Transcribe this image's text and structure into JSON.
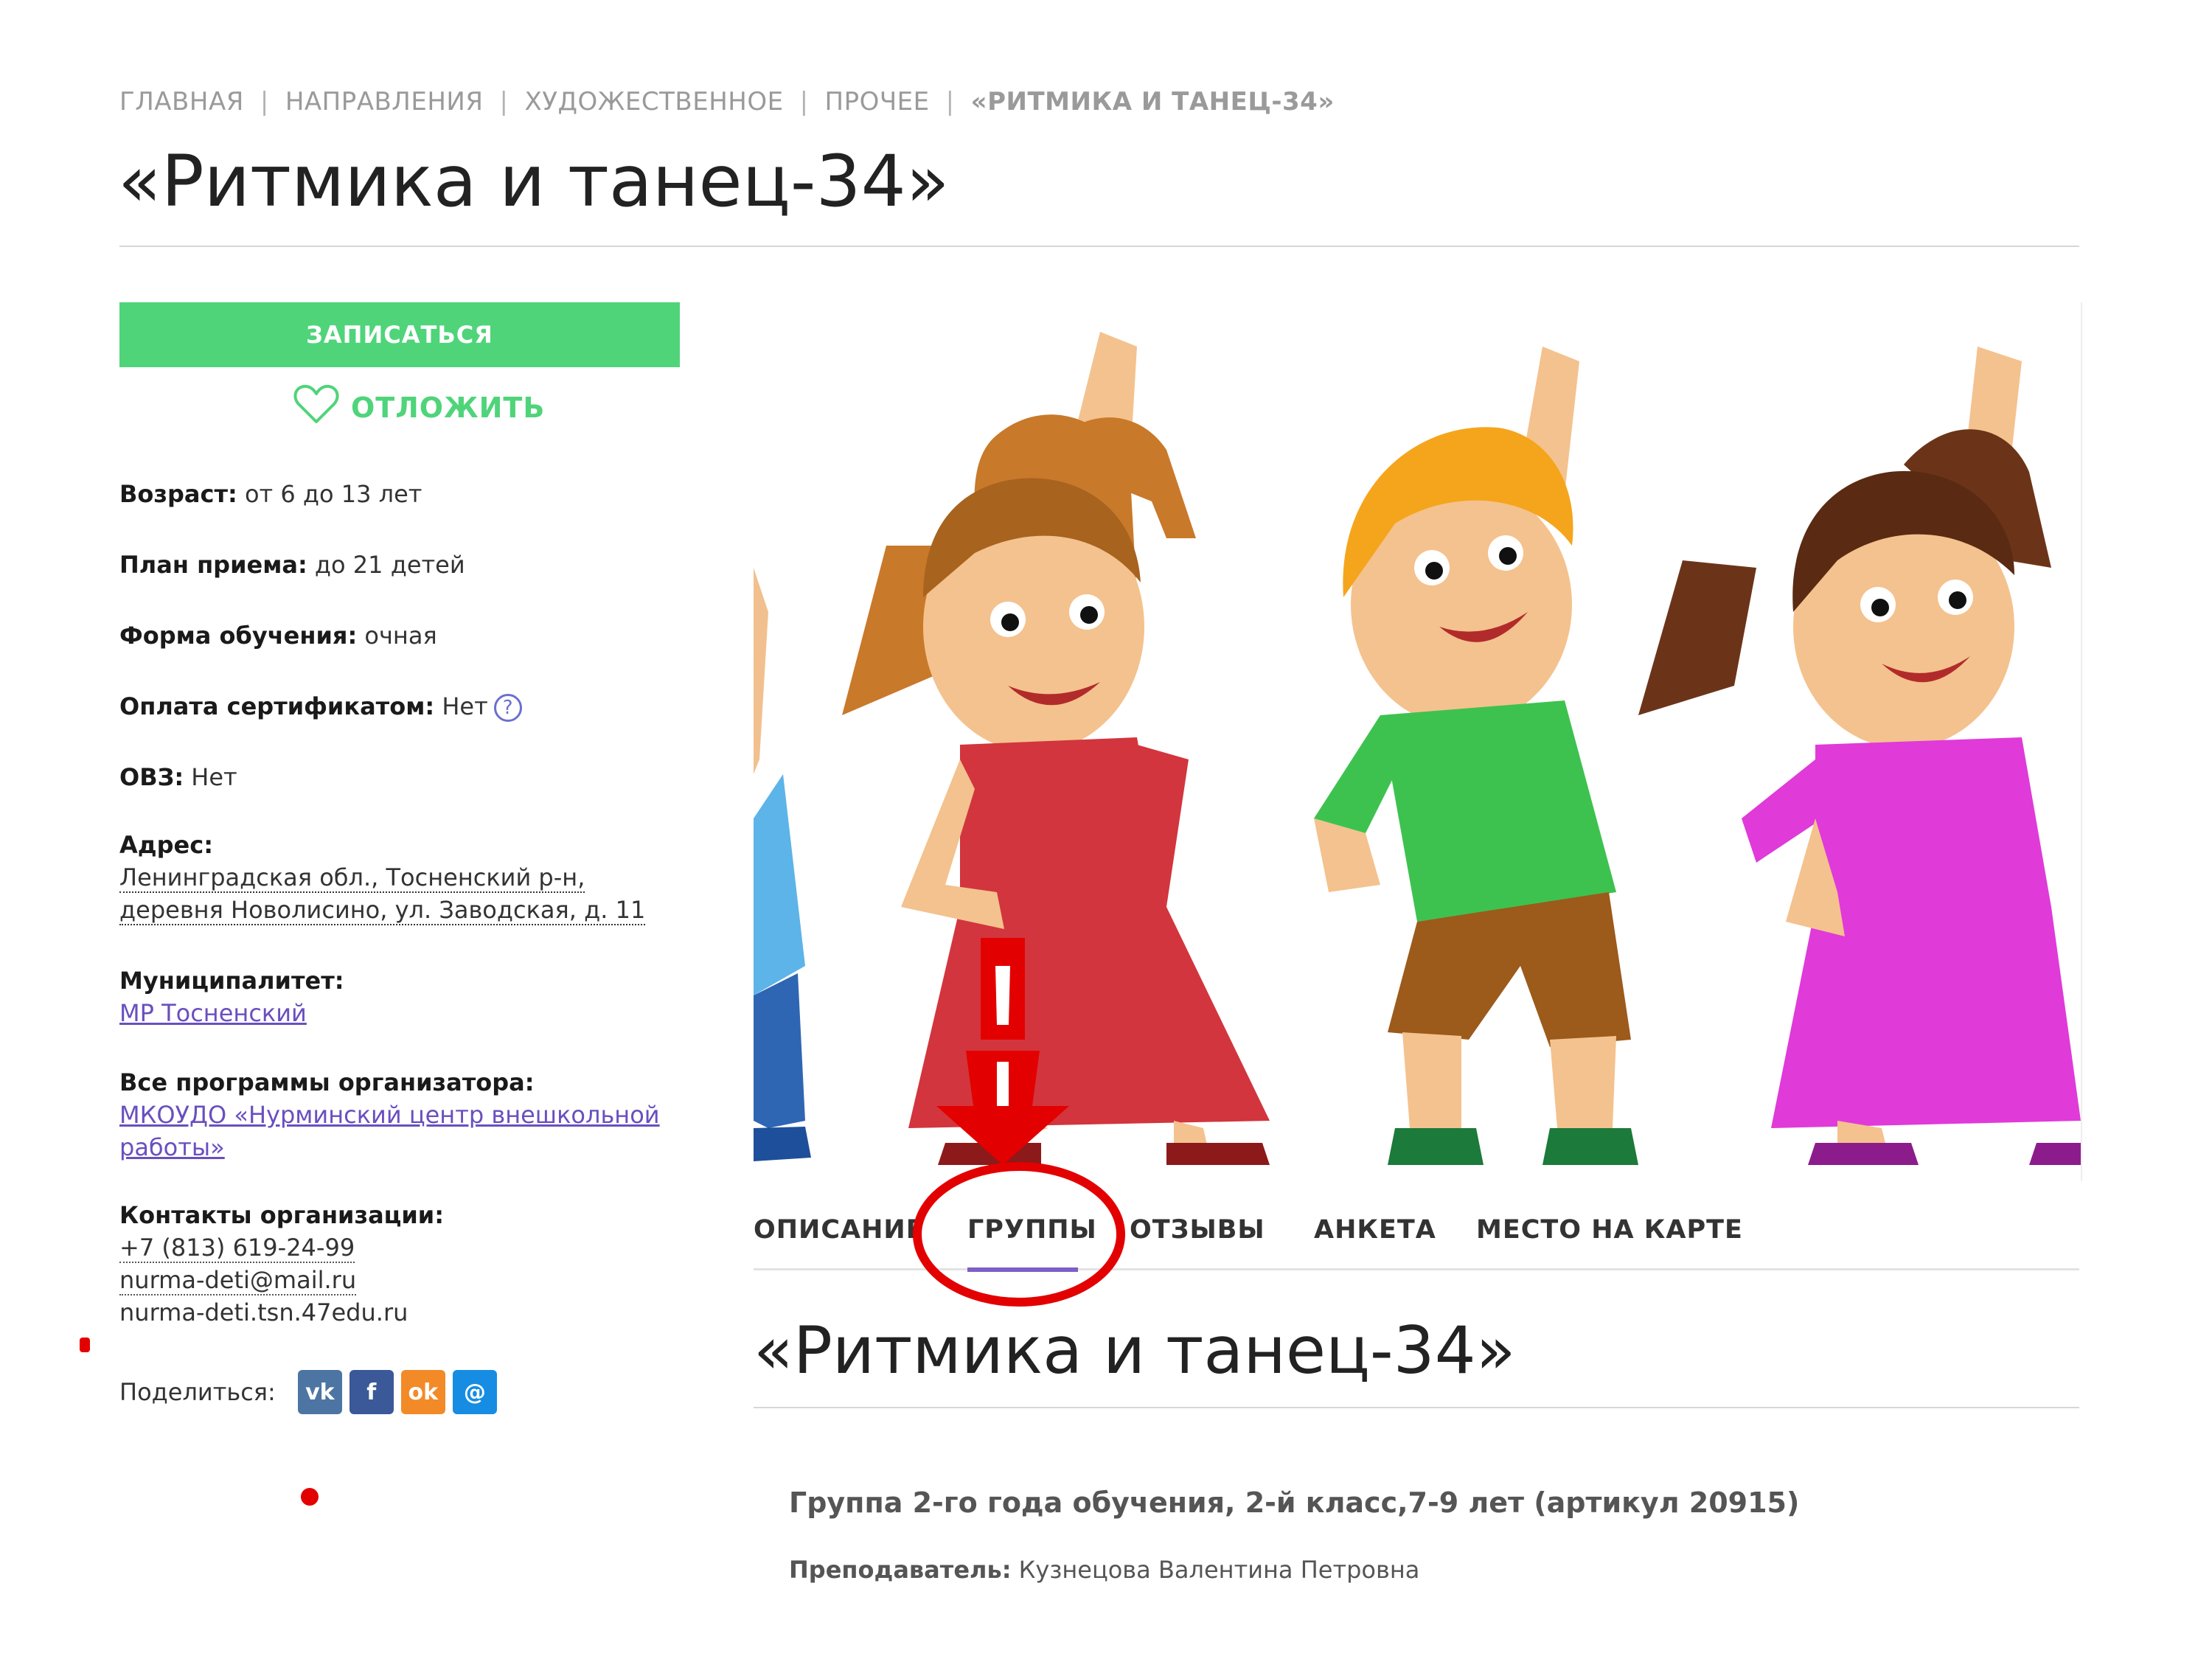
{
  "breadcrumb": {
    "items": [
      "ГЛАВНАЯ",
      "НАПРАВЛЕНИЯ",
      "ХУДОЖЕСТВЕННОЕ",
      "ПРОЧЕЕ"
    ],
    "current": "«РИТМИКА И ТАНЕЦ-34»",
    "separator": "|"
  },
  "page_title": "«Ритмика и танец-34»",
  "actions": {
    "enroll_label": "ЗАПИСАТЬСЯ",
    "defer_label": "ОТЛОЖИТЬ"
  },
  "info": {
    "age_label": "Возраст:",
    "age_value": "от 6 до 13 лет",
    "plan_label": "План приема:",
    "plan_value": "до 21 детей",
    "form_label": "Форма обучения:",
    "form_value": "очная",
    "payment_label": "Оплата сертификатом:",
    "payment_value": "Нет",
    "help_glyph": "?",
    "ovz_label": "ОВЗ:",
    "ovz_value": "Нет",
    "address_label": "Адрес:",
    "address_line1": "Ленинградская обл., Тосненский р-н,",
    "address_line2": "деревня Новолисино, ул. Заводская, д. 11",
    "municipality_label": "Муниципалитет:",
    "municipality_value": "МР Тосненский",
    "programs_label": "Все программы организатора:",
    "programs_line1": "МКОУДО «Нурминский центр внешкольной",
    "programs_line2": "работы»",
    "contacts_label": "Контакты организации:",
    "phone": "+7 (813) 619-24-99",
    "email": "nurma-deti@mail.ru",
    "site": "nurma-deti.tsn.47edu.ru"
  },
  "share": {
    "label": "Поделиться:",
    "vk": "vk",
    "fb": "f",
    "ok": "ok",
    "mm": "@"
  },
  "tabs": [
    {
      "label": "ОПИСАНИЕ"
    },
    {
      "label": "ГРУППЫ",
      "active": true
    },
    {
      "label": "ОТЗЫВЫ"
    },
    {
      "label": "АНКЕТА"
    },
    {
      "label": "МЕСТО НА КАРТЕ"
    }
  ],
  "section_title": "«Ритмика и танец-34»",
  "group": {
    "title": "Группа 2-го года обучения, 2-й класс,7-9 лет (артикул 20915)",
    "teacher_label": "Преподаватель:",
    "teacher_name": "Кузнецова Валентина Петровна"
  },
  "colors": {
    "accent_green": "#4fd47a",
    "accent_purple": "#7d5fc8",
    "annotation_red": "#e30000"
  },
  "icons": {
    "defer": "heart-outline-icon",
    "help": "question-circle-icon",
    "annotation": "exclamation-arrow-icon"
  }
}
